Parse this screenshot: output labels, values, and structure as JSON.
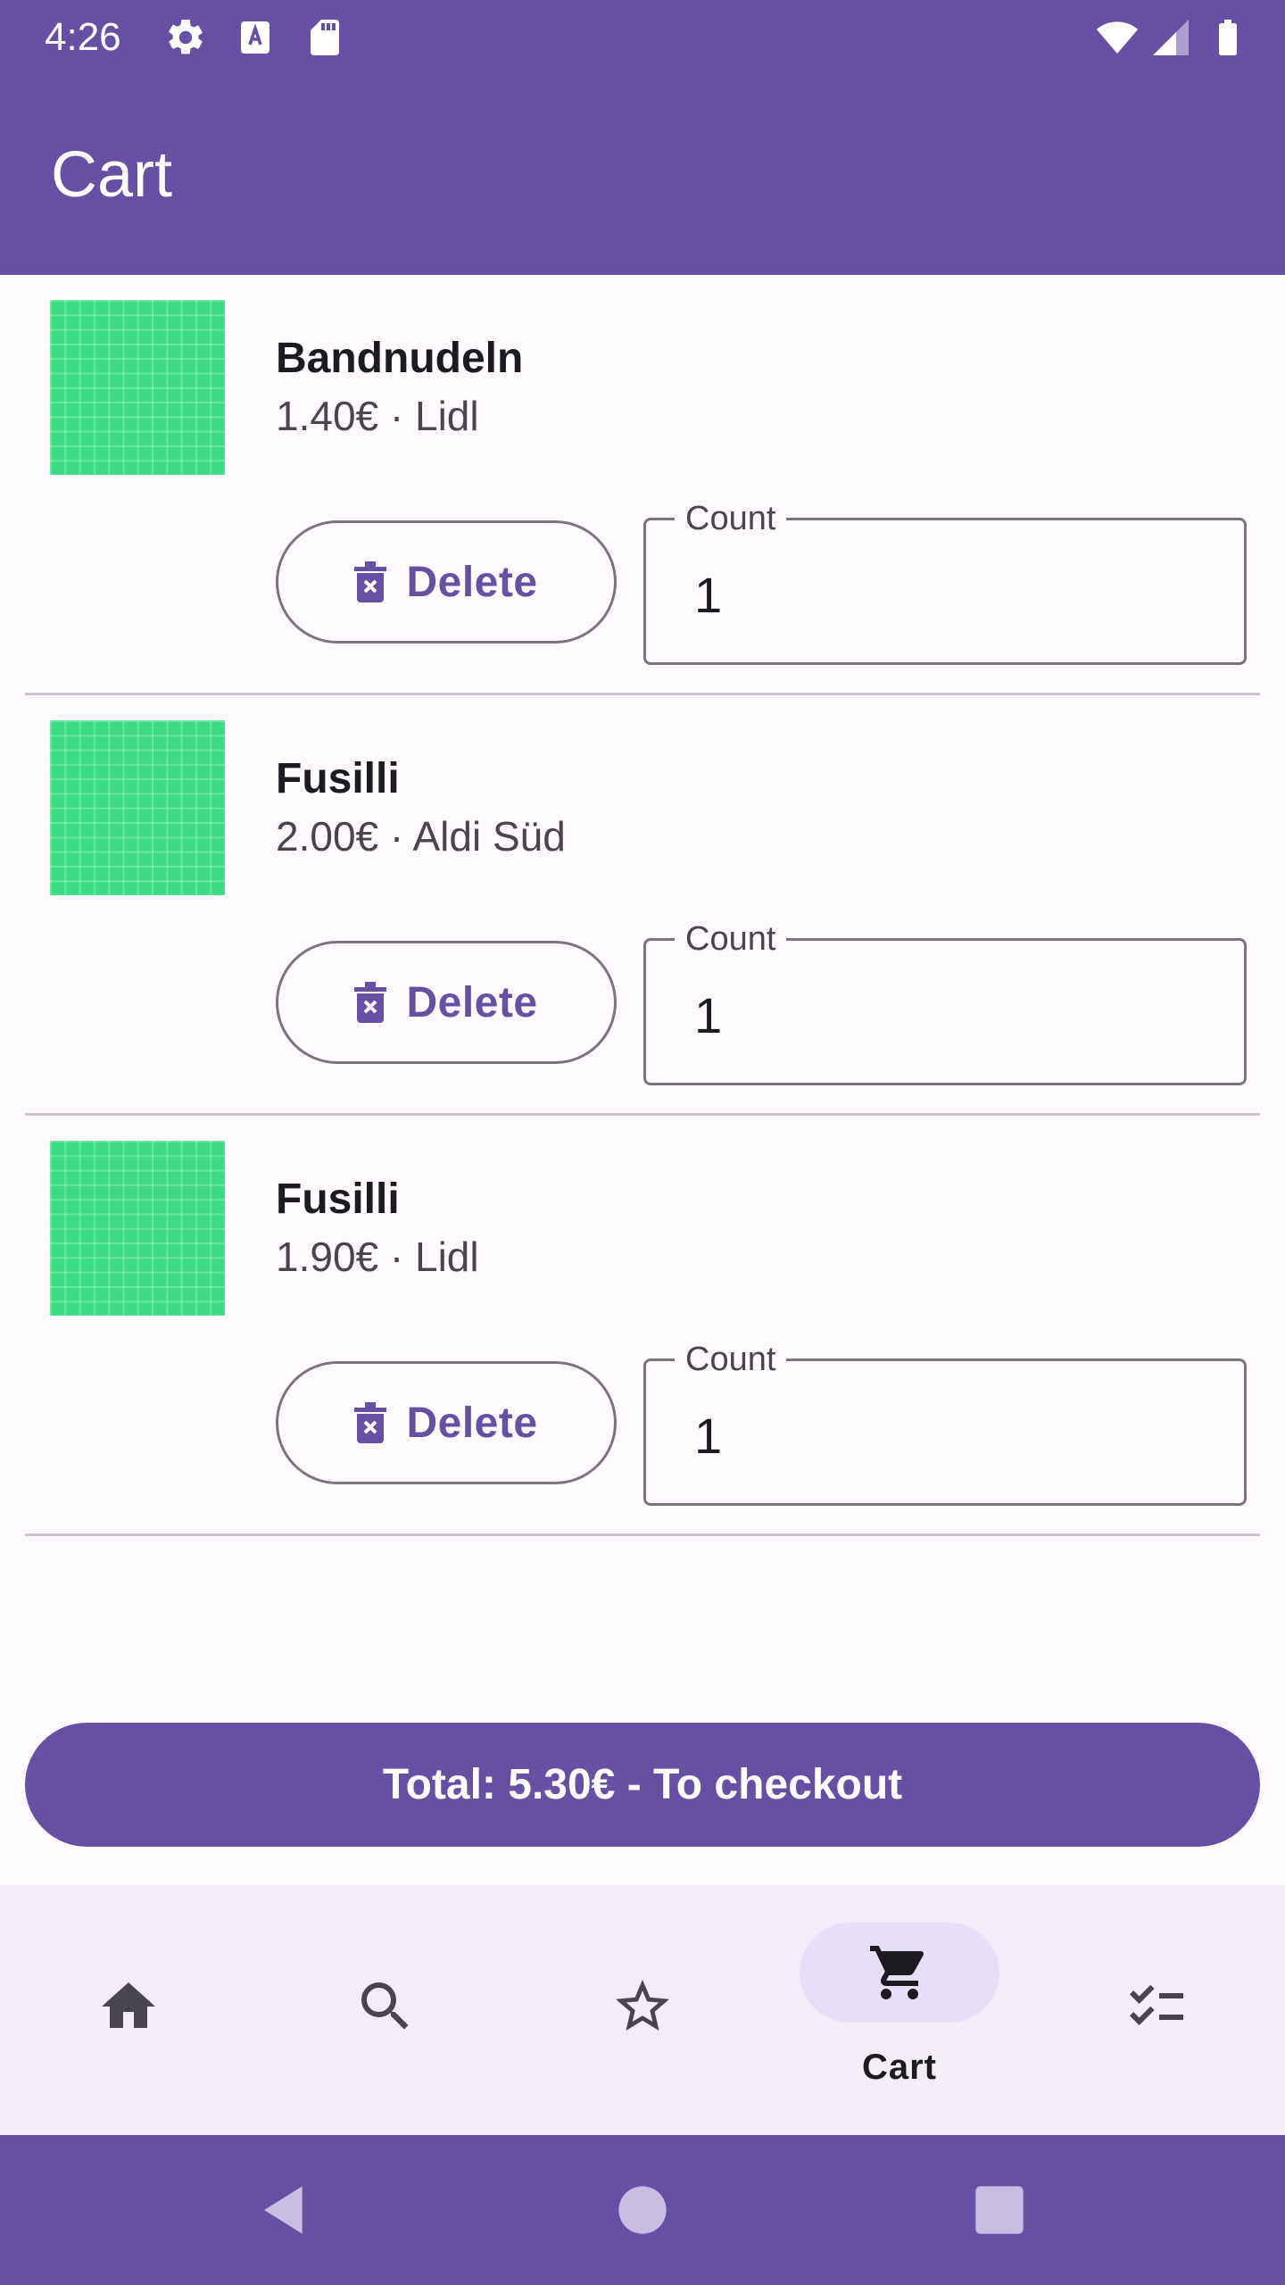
{
  "status_bar": {
    "time": "4:26",
    "icons": [
      "settings-icon",
      "keyboard-a-icon",
      "sd-card-icon",
      "wifi-icon",
      "cell-signal-icon",
      "battery-icon"
    ]
  },
  "app_bar": {
    "title": "Cart"
  },
  "cart": {
    "items": [
      {
        "name": "Bandnudeln",
        "meta": "1.40€ · Lidl",
        "delete_label": "Delete",
        "count_label": "Count",
        "count_value": "1"
      },
      {
        "name": "Fusilli",
        "meta": "2.00€ · Aldi Süd",
        "delete_label": "Delete",
        "count_label": "Count",
        "count_value": "1"
      },
      {
        "name": "Fusilli",
        "meta": "1.90€ · Lidl",
        "delete_label": "Delete",
        "count_label": "Count",
        "count_value": "1"
      }
    ]
  },
  "checkout": {
    "label": "Total: 5.30€ - To checkout"
  },
  "bottom_nav": {
    "items": [
      {
        "icon": "home-icon",
        "label": ""
      },
      {
        "icon": "search-icon",
        "label": ""
      },
      {
        "icon": "star-icon",
        "label": ""
      },
      {
        "icon": "cart-icon",
        "label": "Cart",
        "active": true
      },
      {
        "icon": "checklist-icon",
        "label": ""
      }
    ]
  },
  "system_nav": {
    "buttons": [
      "back-icon",
      "home-circle-icon",
      "recents-icon"
    ]
  },
  "colors": {
    "primary": "#6750a4",
    "thumbnail": "#3ddc84",
    "nav_background": "#f3edf7",
    "nav_active_pill": "#e8def8"
  }
}
